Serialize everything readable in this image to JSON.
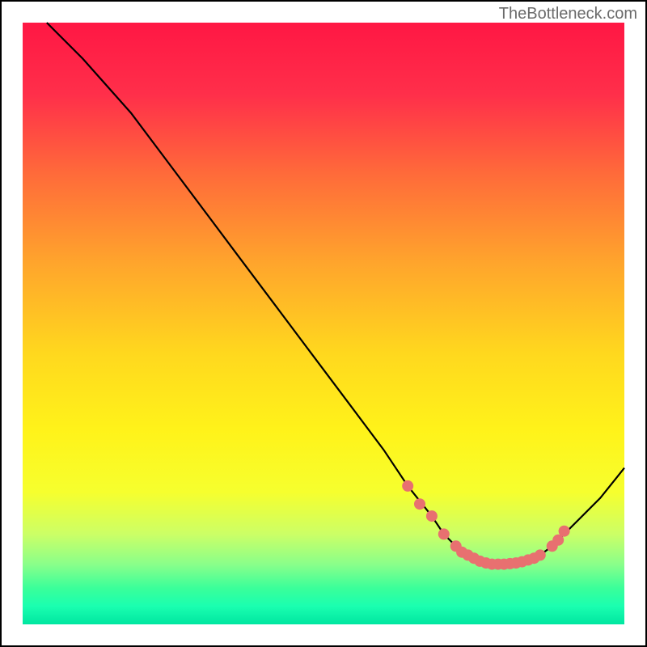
{
  "watermark": "TheBottleneck.com",
  "chart_data": {
    "type": "line",
    "title": "",
    "xlabel": "",
    "ylabel": "",
    "xlim": [
      0,
      100
    ],
    "ylim": [
      0,
      100
    ],
    "grid": false,
    "series": [
      {
        "name": "curve",
        "x": [
          4,
          10,
          18,
          24,
          30,
          36,
          42,
          48,
          54,
          60,
          64,
          68,
          70,
          72,
          74,
          76,
          78,
          80,
          82,
          84,
          86,
          88,
          92,
          96,
          100
        ],
        "y": [
          100,
          94,
          85,
          77,
          69,
          61,
          53,
          45,
          37,
          29,
          23,
          18,
          15,
          13,
          11.5,
          10.5,
          10,
          10,
          10.2,
          10.7,
          11.5,
          13,
          17,
          21,
          26
        ]
      }
    ],
    "markers": {
      "x": [
        64,
        66,
        68,
        70,
        72,
        73,
        74,
        75,
        76,
        77,
        78,
        79,
        80,
        81,
        82,
        83,
        84,
        85,
        86,
        88,
        89,
        90
      ],
      "y": [
        23,
        20,
        18,
        15,
        13,
        12,
        11.5,
        11,
        10.5,
        10.2,
        10,
        10,
        10,
        10.1,
        10.2,
        10.4,
        10.7,
        11,
        11.5,
        13,
        14,
        15.5
      ],
      "color": "#e87070"
    },
    "background": {
      "type": "gradient",
      "stops": [
        {
          "offset": 0,
          "color": "#ff1744"
        },
        {
          "offset": 0.12,
          "color": "#ff2f4a"
        },
        {
          "offset": 0.25,
          "color": "#ff6a3a"
        },
        {
          "offset": 0.4,
          "color": "#ffa52c"
        },
        {
          "offset": 0.55,
          "color": "#ffd81e"
        },
        {
          "offset": 0.68,
          "color": "#fff31a"
        },
        {
          "offset": 0.78,
          "color": "#f6ff2e"
        },
        {
          "offset": 0.85,
          "color": "#ccff66"
        },
        {
          "offset": 0.9,
          "color": "#8aff8a"
        },
        {
          "offset": 0.94,
          "color": "#3aff9a"
        },
        {
          "offset": 0.97,
          "color": "#1affb0"
        },
        {
          "offset": 1.0,
          "color": "#00e6a0"
        }
      ]
    }
  }
}
